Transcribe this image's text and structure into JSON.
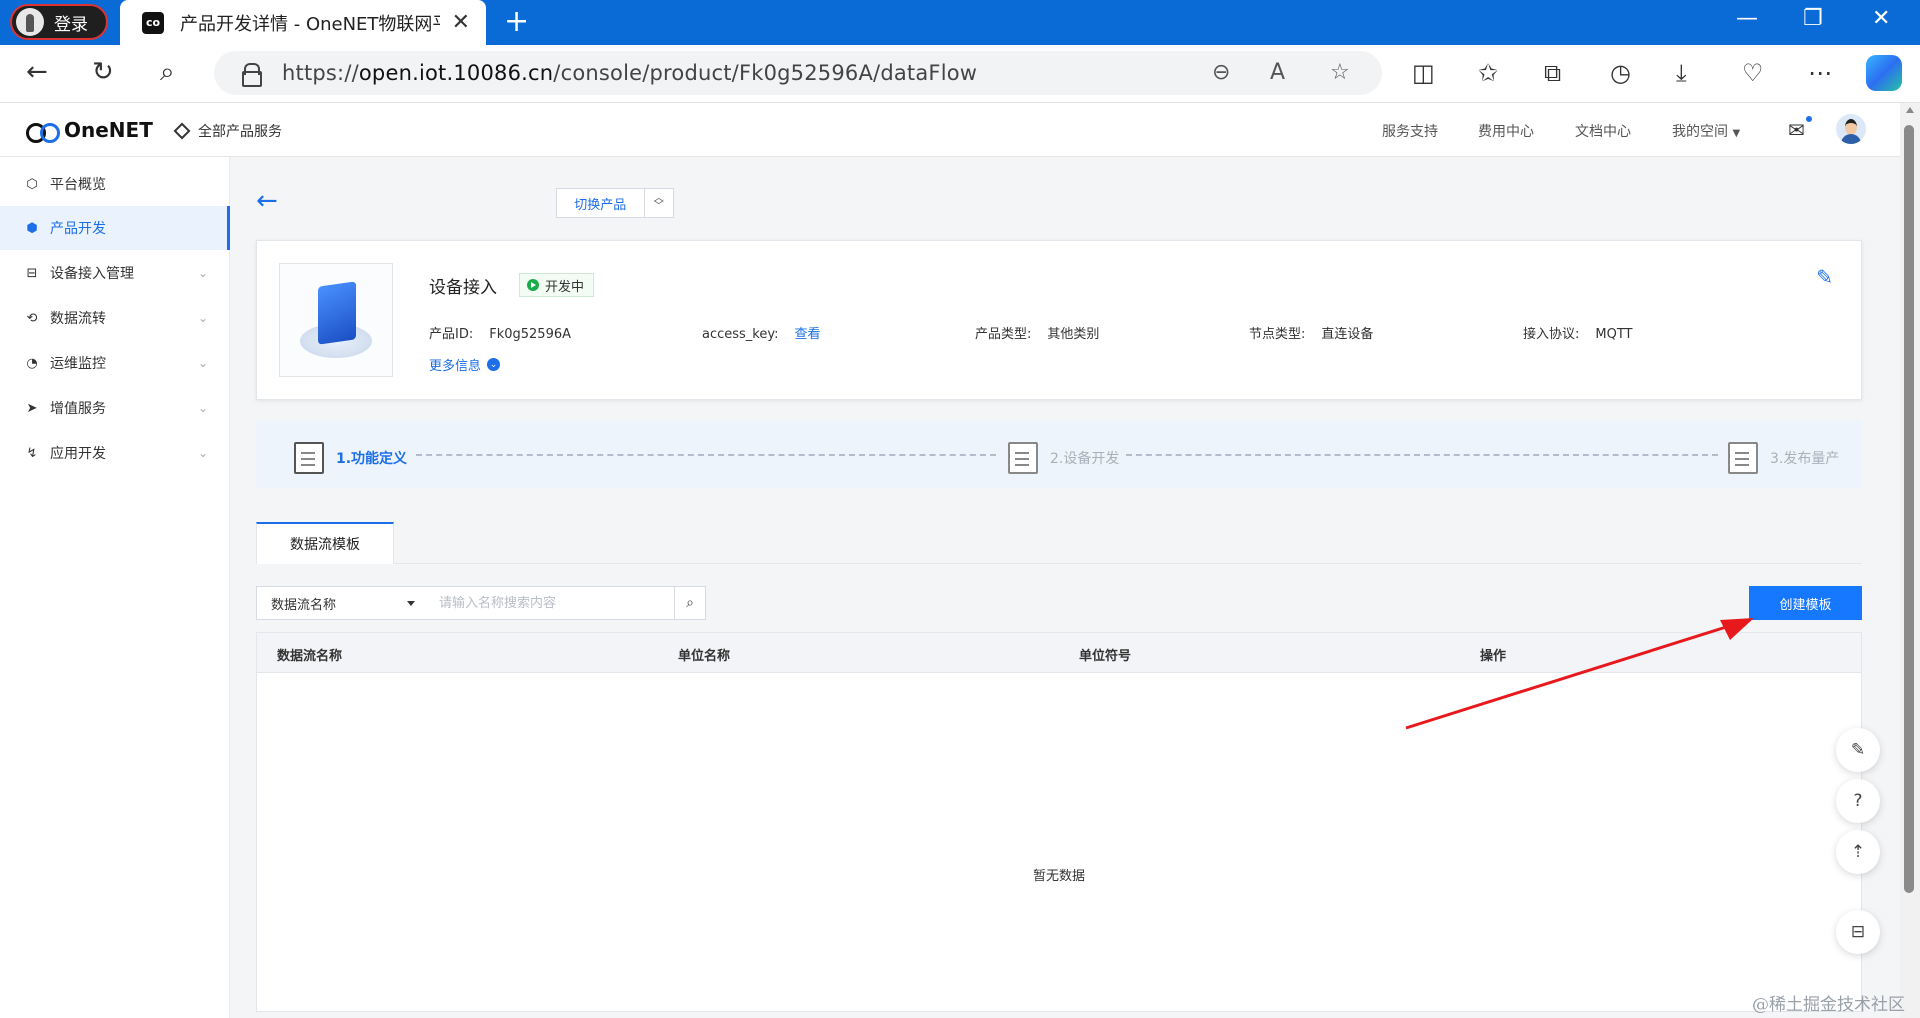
{
  "browser": {
    "profile_label": "登录",
    "tab_title": "产品开发详情 - OneNET物联网平",
    "tab_favicon_icon": "onenet-logo-icon",
    "url_prefix": "https://",
    "url_host": "open.iot.10086.cn",
    "url_path": "/console/product/Fk0g52596A/dataFlow"
  },
  "header": {
    "logo_text": "OneNET",
    "all_services": "全部产品服务",
    "links": [
      "服务支持",
      "费用中心",
      "文档中心",
      "我的空间"
    ],
    "accent_color": "#1c6fe8"
  },
  "sidebar": {
    "items": [
      {
        "label": "平台概览",
        "icon": "overview-icon"
      },
      {
        "label": "产品开发",
        "icon": "cube-icon"
      },
      {
        "label": "设备接入管理",
        "icon": "device-icon"
      },
      {
        "label": "数据流转",
        "icon": "flow-icon"
      },
      {
        "label": "运维监控",
        "icon": "monitor-icon"
      },
      {
        "label": "增值服务",
        "icon": "send-icon"
      },
      {
        "label": "应用开发",
        "icon": "app-icon"
      }
    ],
    "active_index": 1
  },
  "main": {
    "switch_product": "切换产品",
    "product": {
      "name": "设备接入",
      "status": "开发中",
      "status_color": "#1aab4b",
      "fields": [
        {
          "label": "产品ID:",
          "value": "Fk0g52596A",
          "is_link": false
        },
        {
          "label": "access_key:",
          "value": "查看",
          "is_link": true
        },
        {
          "label": "产品类型:",
          "value": "其他类别",
          "is_link": false
        },
        {
          "label": "节点类型:",
          "value": "直连设备",
          "is_link": false
        },
        {
          "label": "接入协议:",
          "value": "MQTT",
          "is_link": false
        }
      ],
      "more_info": "更多信息"
    },
    "steps": [
      {
        "label": "1.功能定义",
        "active": true
      },
      {
        "label": "2.设备开发",
        "active": false
      },
      {
        "label": "3.发布量产",
        "active": false
      }
    ],
    "tab_label": "数据流模板",
    "filter": {
      "select_value": "数据流名称",
      "search_placeholder": "请输入名称搜索内容"
    },
    "create_button": "创建模板",
    "table": {
      "columns": [
        "数据流名称",
        "单位名称",
        "单位符号",
        "操作"
      ],
      "rows": [],
      "empty_text": "暂无数据"
    }
  },
  "watermark": "@稀土掘金技术社区"
}
